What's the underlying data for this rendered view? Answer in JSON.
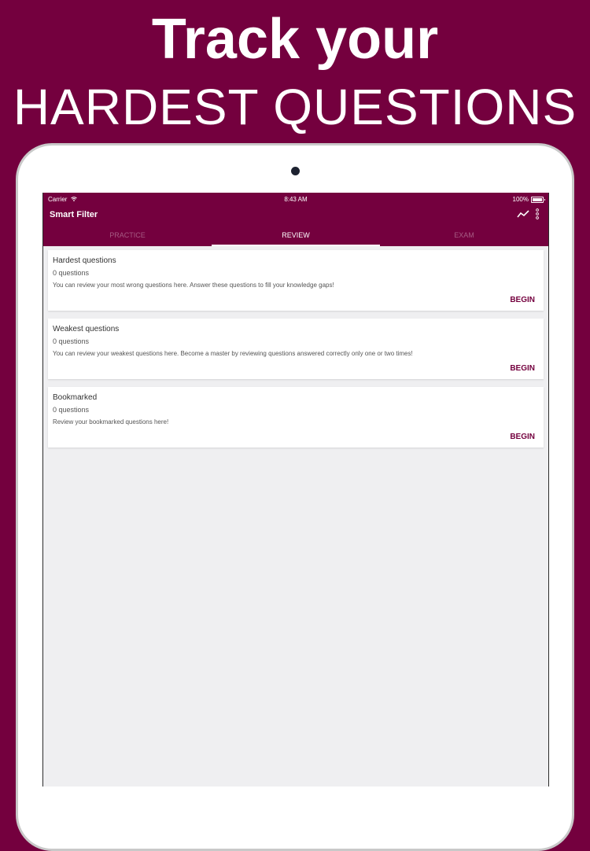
{
  "promo": {
    "line1": "Track your",
    "line2": "HARDEST QUESTIONS"
  },
  "status_bar": {
    "carrier": "Carrier",
    "time": "8:43 AM",
    "battery": "100%"
  },
  "app_bar": {
    "title": "Smart Filter",
    "actions": [
      "trending-chart-icon",
      "more-vertical-icon"
    ]
  },
  "tabs": [
    {
      "label": "PRACTICE",
      "active": false
    },
    {
      "label": "REVIEW",
      "active": true
    },
    {
      "label": "EXAM",
      "active": false
    }
  ],
  "cards": [
    {
      "title": "Hardest questions",
      "count": "0 questions",
      "description": "You can review your most wrong questions here. Answer these questions to fill your knowledge gaps!",
      "action": "BEGIN"
    },
    {
      "title": "Weakest questions",
      "count": "0 questions",
      "description": "You can review your weakest questions here. Become a master by reviewing questions answered correctly only one or two times!",
      "action": "BEGIN"
    },
    {
      "title": "Bookmarked",
      "count": "0 questions",
      "description": "Review your bookmarked questions here!",
      "action": "BEGIN"
    }
  ],
  "colors": {
    "brand": "#74003e",
    "background": "#efeff1"
  }
}
